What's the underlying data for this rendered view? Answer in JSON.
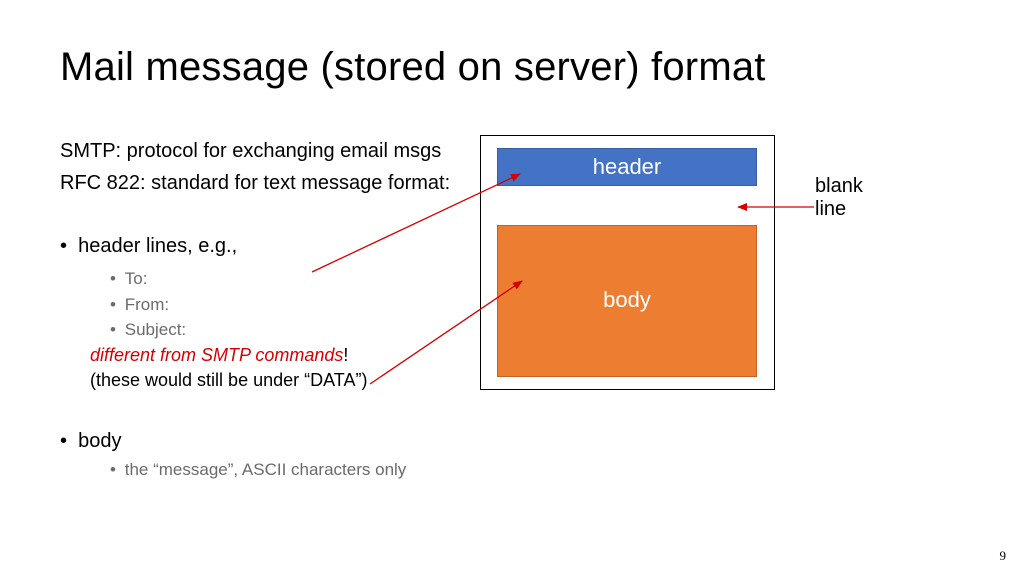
{
  "title": "Mail message (stored on server) format",
  "line1": "SMTP: protocol for exchanging email msgs",
  "line2": "RFC 822: standard for text message format:",
  "bullet_header": "header lines, e.g.,",
  "sub_to": "To:",
  "sub_from": "From:",
  "sub_subject": "Subject:",
  "emphasis": "different from SMTP commands",
  "under_data": "(these would still be under “DATA”)",
  "bullet_body": "body",
  "sub_body_desc": "the “message”, ASCII characters only",
  "fig_header": "header",
  "fig_body": "body",
  "blank_line_label_1": "blank",
  "blank_line_label_2": "line",
  "page_number": "9",
  "bullet_char": "•"
}
